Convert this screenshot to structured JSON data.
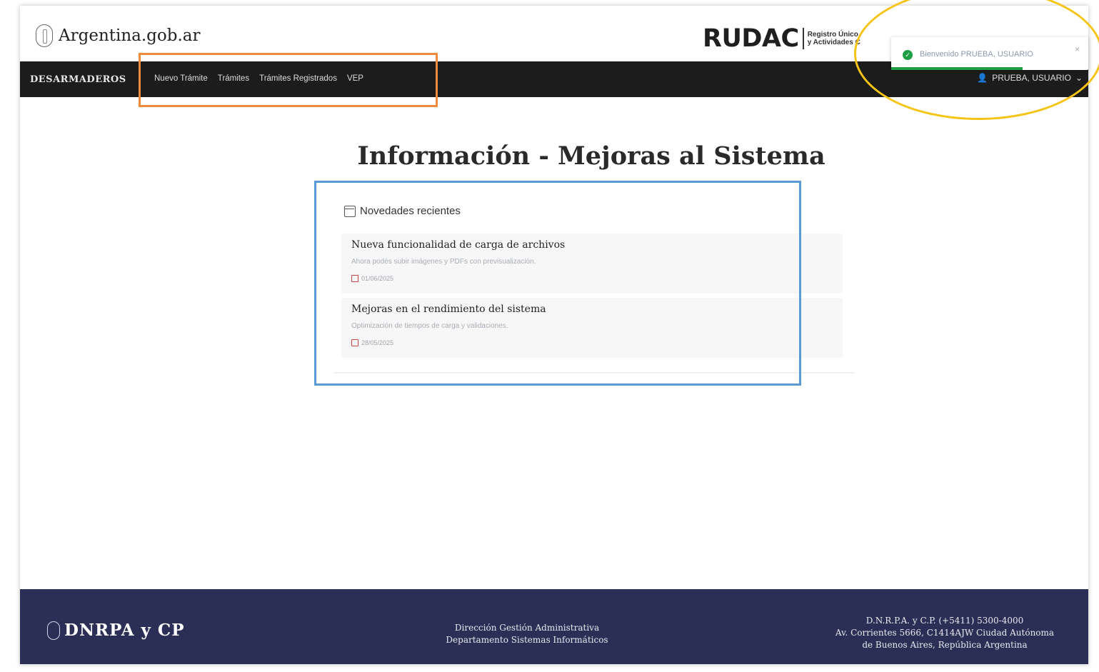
{
  "header": {
    "gov_name": "Argentina.gob.ar",
    "rudac_logo": "RUDAC",
    "rudac_sub_line1": "Registro Único",
    "rudac_sub_line2": "y Actividades C"
  },
  "toast": {
    "message": "Bienvenido PRUEBA, USUARIO",
    "close": "×",
    "status_icon": "check-circle-icon",
    "color": "#1e9e45"
  },
  "navbar": {
    "brand": "DESARMADEROS",
    "links": [
      "Nuevo Trámite",
      "Trámites",
      "Trámites Registrados",
      "VEP"
    ],
    "user": "PRUEBA, USUARIO",
    "user_caret": "⌄"
  },
  "main": {
    "title": "Información - Mejoras al Sistema",
    "news": {
      "heading": "Novedades recientes",
      "items": [
        {
          "title": "Nueva funcionalidad de carga de archivos",
          "description": "Ahora podés subir imágenes y PDFs con previsualización.",
          "date": "01/06/2025"
        },
        {
          "title": "Mejoras en el rendimiento del sistema",
          "description": "Optimización de tiempos de carga y validaciones.",
          "date": "28/05/2025"
        }
      ]
    }
  },
  "footer": {
    "logo": "DNRPA y CP",
    "middle_line1": "Dirección Gestión Administrativa",
    "middle_line2": "Departamento Sistemas Informáticos",
    "right_line1": "D.N.R.P.A. y C.P. (+5411) 5300-4000",
    "right_line2": "Av. Corrientes 5666, C1414AJW Ciudad Autónoma",
    "right_line3": "de Buenos Aires, República Argentina"
  },
  "annotations": {
    "orange": "#ef8a3b",
    "blue": "#5b9bd5",
    "yellow": "#f6c415"
  }
}
